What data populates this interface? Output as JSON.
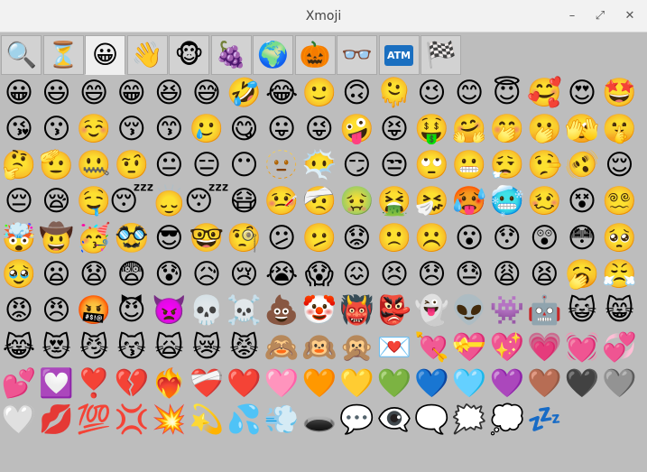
{
  "window": {
    "title": "Xmoji",
    "minimize_glyph": "–",
    "maximize_glyph": "⤢",
    "close_glyph": "✕"
  },
  "tabs": [
    {
      "name": "search",
      "glyph": "🔍"
    },
    {
      "name": "recent",
      "glyph": "⏳"
    },
    {
      "name": "smileys",
      "glyph": "😀",
      "active": true
    },
    {
      "name": "people",
      "glyph": "👋"
    },
    {
      "name": "animals",
      "glyph": "🐵"
    },
    {
      "name": "food",
      "glyph": "🍇"
    },
    {
      "name": "travel",
      "glyph": "🌍"
    },
    {
      "name": "activities",
      "glyph": "🎃"
    },
    {
      "name": "objects",
      "glyph": "👓"
    },
    {
      "name": "symbols",
      "glyph": "ATM"
    },
    {
      "name": "flags",
      "glyph": "🏁"
    }
  ],
  "emoji_rows": [
    [
      "😀",
      "😃",
      "😄",
      "😁",
      "😆",
      "😅",
      "🤣",
      "😂",
      "🙂",
      "🙃",
      "🫠",
      "😉",
      "😊",
      "😇",
      "🥰",
      "😍",
      "🤩"
    ],
    [
      "😘",
      "😗",
      "☺️",
      "😚",
      "😙",
      "🥲",
      "😋",
      "😛",
      "😜",
      "🤪",
      "😝",
      "🤑",
      "🤗",
      "🤭",
      "🫢",
      "🫣",
      "🤫"
    ],
    [
      "🤔",
      "🫡",
      "🤐",
      "🤨",
      "😐",
      "😑",
      "😶",
      "🫥",
      "😶‍🌫️",
      "😏",
      "😒",
      "🙄",
      "😬",
      "😮‍💨",
      "🤥",
      "🫨",
      "😌"
    ],
    [
      "😔",
      "😪",
      "🤤",
      "😴",
      "🙂‍↕️",
      "😴",
      "😷",
      "🤒",
      "🤕",
      "🤢",
      "🤮",
      "🤧",
      "🥵",
      "🥶",
      "🥴",
      "😵",
      "😵‍💫"
    ],
    [
      "🤯",
      "🤠",
      "🥳",
      "🥸",
      "😎",
      "🤓",
      "🧐",
      "😕",
      "🫤",
      "😟",
      "🙁",
      "☹️",
      "😮",
      "😯",
      "😲",
      "😳",
      "🥺"
    ],
    [
      "🥹",
      "😦",
      "😧",
      "😨",
      "😰",
      "😥",
      "😢",
      "😭",
      "😱",
      "😖",
      "😣",
      "😞",
      "😓",
      "😩",
      "😫",
      "🥱",
      "😤"
    ],
    [
      "😡",
      "😠",
      "🤬",
      "😈",
      "👿",
      "💀",
      "☠️",
      "💩",
      "🤡",
      "👹",
      "👺",
      "👻",
      "👽",
      "👾",
      "🤖",
      "😺",
      "😸"
    ],
    [
      "😹",
      "😻",
      "😼",
      "😽",
      "🙀",
      "😿",
      "😾",
      "🙈",
      "🙉",
      "🙊",
      "💌",
      "💘",
      "💝",
      "💖",
      "💗",
      "💓",
      "💞"
    ],
    [
      "💕",
      "💟",
      "❣️",
      "💔",
      "❤️‍🔥",
      "❤️‍🩹",
      "❤️",
      "🩷",
      "🧡",
      "💛",
      "💚",
      "💙",
      "🩵",
      "💜",
      "🤎",
      "🖤",
      "🩶"
    ],
    [
      "🤍",
      "💋",
      "💯",
      "💢",
      "💥",
      "💫",
      "💦",
      "💨",
      "🕳️",
      "💬",
      "👁️‍🗨️",
      "🗨️",
      "🗯️",
      "💭",
      "💤"
    ]
  ]
}
